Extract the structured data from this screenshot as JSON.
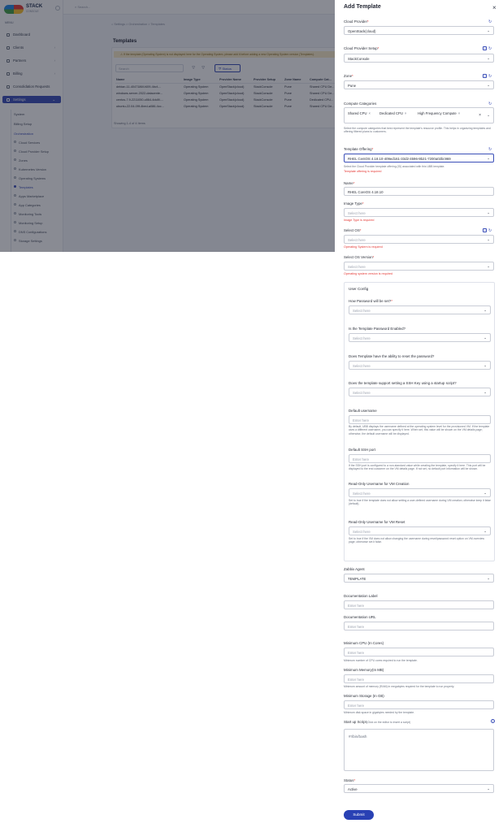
{
  "app": {
    "logo_name": "STACK",
    "logo_sub": "CONSOLE",
    "menu_heading": "MENU",
    "search_placeholder": "Search..."
  },
  "sidebar": {
    "items": [
      {
        "label": "Dashboard",
        "chevron": ""
      },
      {
        "label": "Clients",
        "chevron": "›"
      },
      {
        "label": "Partners",
        "chevron": "›"
      },
      {
        "label": "Billing",
        "chevron": "›"
      },
      {
        "label": "Consolidation Requests",
        "chevron": ""
      },
      {
        "label": "Settings",
        "chevron": "⌄"
      }
    ],
    "settings_children": [
      "System",
      "Billing Setup",
      "Orchestration"
    ],
    "orchestration_children": [
      "Cloud Services",
      "Cloud Provider Setup",
      "Zones",
      "Kubernetes Version",
      "Operating Systems",
      "Templates",
      "Apps Marketplace",
      "App Categories",
      "Monitoring Tools",
      "Monitoring Setup",
      "DNS Configurations",
      "Storage Settings"
    ],
    "active_child": "Templates"
  },
  "page": {
    "breadcrumb": "Settings  >  Orchestration  >  Templates",
    "title": "Templates",
    "warning": "If the template (Operating System) is not displayed here for the Operating System, please add it before adding a new Operating System version (Templates).",
    "table_search_placeholder": "Search",
    "status_button": "Status",
    "columns": [
      "Name",
      "Image Type",
      "Provider Name",
      "Provider Setup",
      "Zone Name",
      "Compute Cat..."
    ],
    "rows": [
      [
        "debian-11-4047186f-f409-4bcf-...",
        "Operating System",
        "OpenStack(cloud)",
        "StackConsole",
        "Pune",
        "Shared CPU De..."
      ],
      [
        "windows-server-2022-datacente...",
        "Operating System",
        "OpenStack(cloud)",
        "StackConsole",
        "Pune",
        "Shared CPU De..."
      ],
      [
        "centos-7.9-2211050-c864-4dc8f-...",
        "Operating System",
        "OpenStack(cloud)",
        "StackConsole",
        "Pune",
        "Dedicated CPU..."
      ],
      [
        "ubuntu-22.04-09f-4bed-a086-4cc...",
        "Operating System",
        "OpenStack(cloud)",
        "StackConsole",
        "Pune",
        "Shared CPU De..."
      ]
    ],
    "footer": "Showing 1-4 of 4 Items"
  },
  "panel": {
    "title": "Add Template",
    "close": "×",
    "cloud_provider": {
      "label": "Cloud Provider",
      "value": "OpenStack(cloud)"
    },
    "cloud_provider_setup": {
      "label": "Cloud Provider Setup",
      "value": "StackConsole"
    },
    "zone": {
      "label": "Zone",
      "value": "Pune"
    },
    "compute_categories": {
      "label": "Compute Categories",
      "chips": [
        "Shared CPU",
        "Dedicated CPU",
        "High Frequency Compute"
      ],
      "help": "Select the compute categories that best represent the template's resource profile. This helps in organizing templates and offering filtered plans to customers."
    },
    "template_offering": {
      "label": "Template Offering",
      "value": "RHEL CentOS 4.18.10-409ed161-33d2-4596-9b21-7200a02bc969",
      "help": "Select the Cloud Provider template offering (ID) associated with this UBB template.",
      "error": "Template offering is required"
    },
    "name": {
      "label": "Name",
      "value": "RHEL CoreOS 4.18.10"
    },
    "image_type": {
      "label": "Image Type",
      "placeholder": "Select here",
      "error": "Image Type is required"
    },
    "select_os": {
      "label": "Select OS",
      "placeholder": "Select here",
      "error": "Operating System is required"
    },
    "select_os_version": {
      "label": "Select OS Version",
      "placeholder": "Select here",
      "error": "Operating system version is required"
    },
    "user_config": {
      "title": "User Config",
      "password_set": {
        "label": "How Password will be set?",
        "placeholder": "Select here"
      },
      "password_enabled": {
        "label": "Is the Template Password Enabled?",
        "placeholder": "Select here"
      },
      "reset_password": {
        "label": "Does Template have the ability to reset the password?",
        "placeholder": "Select here"
      },
      "ssh_key": {
        "label": "Does the template support setting a SSH Key using a startup script?",
        "placeholder": "Select here"
      },
      "default_username": {
        "label": "Default username",
        "placeholder": "Enter here",
        "help": "By default, UBB displays the username defined at the operating system level for the provisioned VM. If the template uses a different username, you can specify it here. When set, this value will be shown on the VM details page; otherwise, the default username will be displayed."
      },
      "default_ssh_port": {
        "label": "Default SSH port",
        "placeholder": "Enter here",
        "help": "If the SSH port is configured to a non-standard value while creating the template, specify it here. This port will be displayed to the end customer on the VM details page. If not set, no default port information will be shown."
      },
      "readonly_creation": {
        "label": "Read-Only Username for VM Creation",
        "placeholder": "Select here",
        "help": "Set to true if the template does not allow setting a user-defined username during VM creation; otherwise keep it false (default)."
      },
      "readonly_reset": {
        "label": "Read-Only Username for VM Reset",
        "placeholder": "Select here",
        "help": "Set to true if the VM does not allow changing the username during reset/password reset option on VM overview page; otherwise set it false."
      }
    },
    "zabbix_agent": {
      "label": "Zabbix Agent",
      "value": "TEMPLATE"
    },
    "documentation_label": {
      "label": "Documentation Label",
      "placeholder": "Enter here"
    },
    "documentation_url": {
      "label": "Documentation URL",
      "placeholder": "Enter here"
    },
    "min_cpu": {
      "label": "Minimum CPU (In Cores)",
      "placeholder": "Enter here",
      "help": "Minimum number of CPU cores required to run the template."
    },
    "min_memory": {
      "label": "Minimum Memory(In MB)",
      "placeholder": "Enter here",
      "help": "Minimum amount of memory (RAM) in megabytes required for the template to run properly."
    },
    "min_storage": {
      "label": "Minimum Storage (In GB)",
      "placeholder": "Enter here",
      "help": "Minimum disk space in gigabytes needed by the template."
    },
    "startup_script": {
      "label": "Start up Script",
      "label_note": "(Click on the editor to insert a script)",
      "value": "#!/bin/bash"
    },
    "status": {
      "label": "Status",
      "value": "Active"
    },
    "submit": "Submit"
  },
  "colors": {
    "accent": "#2941b4",
    "error": "#e53935",
    "warning_bg": "#fbecc9"
  }
}
